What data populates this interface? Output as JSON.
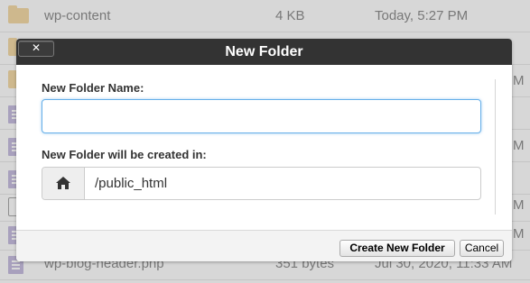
{
  "file_list": {
    "rows": [
      {
        "icon": "folder-icon",
        "name": "wp-content",
        "size": "4 KB",
        "date": "Today, 5:27 PM"
      },
      {
        "icon": "folder-icon",
        "name": "",
        "size": "",
        "date": ""
      },
      {
        "icon": "folder-icon",
        "name": "",
        "size": "",
        "date": "M"
      },
      {
        "icon": "document-icon",
        "name": "",
        "size": "",
        "date": ""
      },
      {
        "icon": "document-icon",
        "name": "",
        "size": "",
        "date": "M"
      },
      {
        "icon": "document-icon",
        "name": "",
        "size": "",
        "date": ""
      },
      {
        "icon": "image-icon",
        "name": "",
        "size": "",
        "date": "M"
      },
      {
        "icon": "document-icon",
        "name": "",
        "size": "",
        "date": "M"
      },
      {
        "icon": "document-icon",
        "name": "wp-blog-header.php",
        "size": "351 bytes",
        "date": "Jul 30, 2020, 11:33 AM"
      }
    ]
  },
  "dialog": {
    "title": "New Folder",
    "close_label": "✕",
    "folder_name_label": "New Folder Name:",
    "folder_name_value": "",
    "location_label": "New Folder will be created in:",
    "location_path": "/public_html",
    "create_button": "Create New Folder",
    "cancel_button": "Cancel"
  },
  "icons": {
    "close": "close-icon",
    "home": "home-icon"
  },
  "colors": {
    "titlebar": "#333333",
    "input_focus_border": "#66afe9",
    "folder": "#f1cd88",
    "document": "#b3a7d6"
  }
}
